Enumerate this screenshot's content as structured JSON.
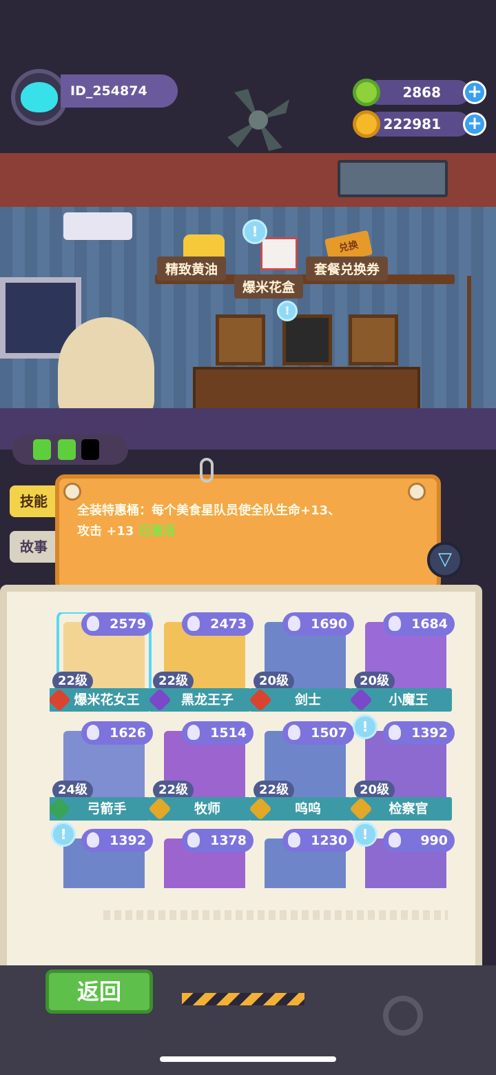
{
  "player": {
    "id": "ID_254874"
  },
  "currency": {
    "donut": "2868",
    "coin": "222981",
    "plus": "+"
  },
  "shop": {
    "labels": [
      "精致黄油",
      "爆米花盒",
      "套餐兑换券"
    ],
    "coupon_tag": "兑换"
  },
  "tabs": {
    "skill": "技能",
    "story": "故事"
  },
  "bonus": {
    "text_part1": "全装特惠桶：每个美食星队员使全队生命",
    "value1": "+13、",
    "text_part2": "攻击",
    "value2": "+13",
    "status": "已激活"
  },
  "characters": [
    {
      "name": "爆米花女王",
      "level": "22级",
      "power": "2579",
      "role_color": "#d9442f",
      "art_color": "#f3d493",
      "selected": true,
      "alert": false
    },
    {
      "name": "黑龙王子",
      "level": "22级",
      "power": "2473",
      "role_color": "#7a48c9",
      "art_color": "#f2c15a",
      "selected": false,
      "alert": false
    },
    {
      "name": "剑士",
      "level": "20级",
      "power": "1690",
      "role_color": "#d9442f",
      "art_color": "#6e86c9",
      "selected": false,
      "alert": false
    },
    {
      "name": "小魔王",
      "level": "20级",
      "power": "1684",
      "role_color": "#7a48c9",
      "art_color": "#9a6ad6",
      "selected": false,
      "alert": false
    },
    {
      "name": "弓箭手",
      "level": "24级",
      "power": "1626",
      "role_color": "#3aa35a",
      "art_color": "#7f8ed0",
      "selected": false,
      "alert": false
    },
    {
      "name": "牧师",
      "level": "22级",
      "power": "1514",
      "role_color": "#e2a827",
      "art_color": "#9b64cf",
      "selected": false,
      "alert": false
    },
    {
      "name": "呜呜",
      "level": "22级",
      "power": "1507",
      "role_color": "#e2a827",
      "art_color": "#6e86c9",
      "selected": false,
      "alert": false
    },
    {
      "name": "检察官",
      "level": "20级",
      "power": "1392",
      "role_color": "#e2a827",
      "art_color": "#8c6ad0",
      "selected": false,
      "alert": true
    },
    {
      "name": "",
      "level": "",
      "power": "1392",
      "role_color": "#e2a827",
      "art_color": "#6e86c9",
      "selected": false,
      "alert": true
    },
    {
      "name": "",
      "level": "",
      "power": "1378",
      "role_color": "#e2a827",
      "art_color": "#9b64cf",
      "selected": false,
      "alert": false
    },
    {
      "name": "",
      "level": "",
      "power": "1230",
      "role_color": "#e2a827",
      "art_color": "#6e86c9",
      "selected": false,
      "alert": false
    },
    {
      "name": "",
      "level": "",
      "power": "990",
      "role_color": "#e2a827",
      "art_color": "#8c6ad0",
      "selected": false,
      "alert": true
    }
  ],
  "footer": {
    "back_label": "返回"
  },
  "icons": {
    "filter": "filter-icon",
    "alert": "!"
  }
}
